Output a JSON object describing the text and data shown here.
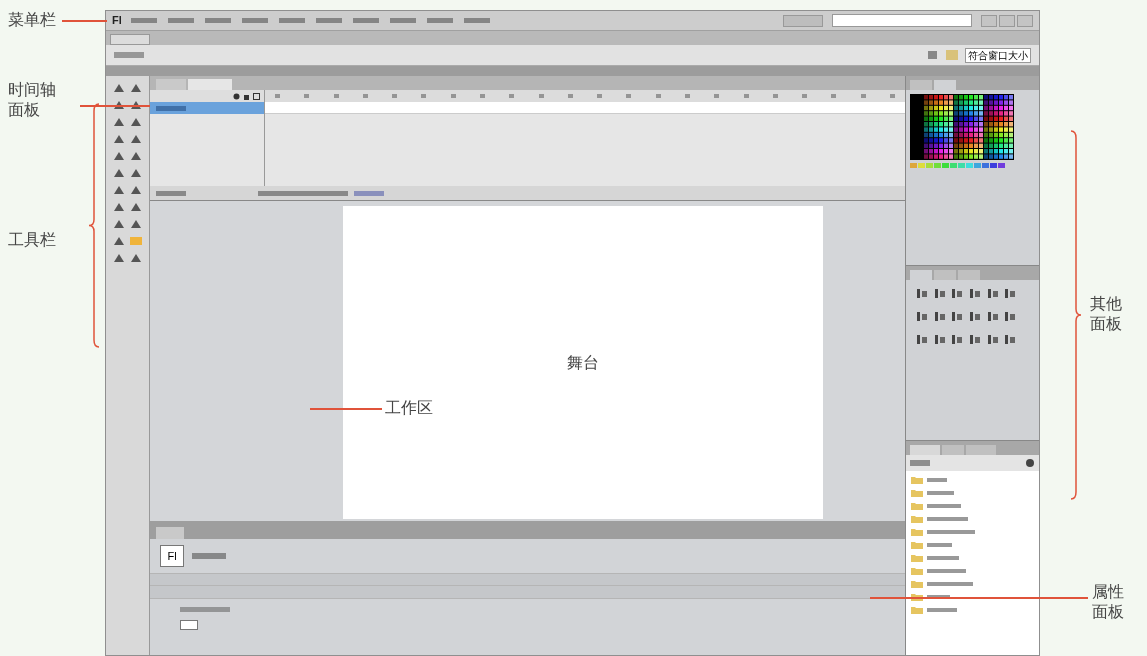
{
  "menu_bar": {
    "logo": "Fl"
  },
  "edit_bar": {
    "zoom_dropdown": "符合窗口大小"
  },
  "stage": {
    "label": "舞台"
  },
  "properties_panel": {
    "doc_icon": "Fl"
  },
  "annotations": [
    {
      "kind": "line",
      "label": "菜单栏"
    },
    {
      "kind": "line",
      "label": "时间轴面板"
    },
    {
      "kind": "brace",
      "label": "工具栏"
    },
    {
      "kind": "inner-line",
      "label": "工作区"
    },
    {
      "kind": "brace",
      "label": "其他面板"
    },
    {
      "kind": "line",
      "label": "属性面板"
    }
  ]
}
